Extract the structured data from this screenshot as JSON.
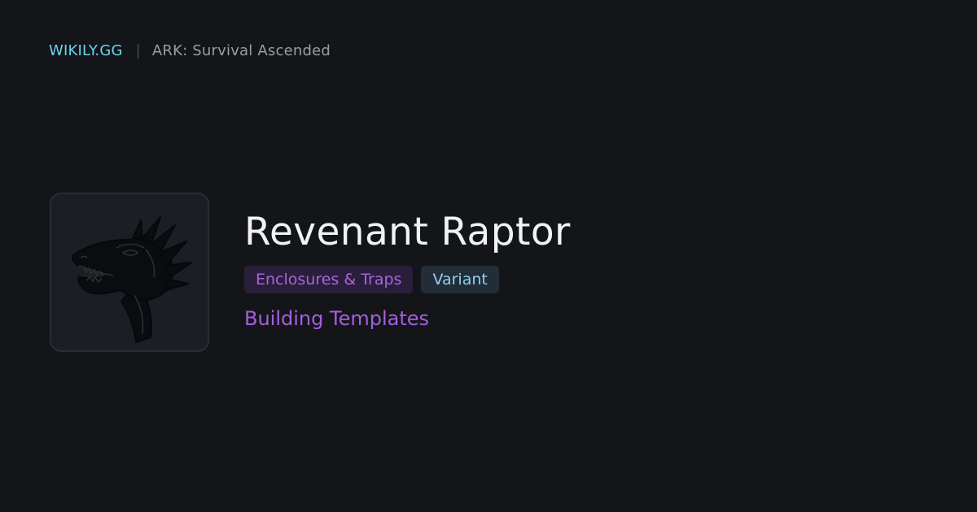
{
  "header": {
    "brand": "WIKILY.GG",
    "separator": "|",
    "game": "ARK: Survival Ascended"
  },
  "item": {
    "icon": "raptor-head-icon",
    "title": "Revenant Raptor",
    "tags": [
      "Enclosures & Traps",
      "Variant"
    ],
    "subtitle": "Building Templates"
  },
  "colors": {
    "background": "#141519",
    "brand": "#67d4ef",
    "accent_purple": "#a45fe0",
    "tag_category_bg": "#2a1e3a",
    "tag_variant_bg": "#222d38",
    "tag_variant_text": "#8fd3ec"
  }
}
